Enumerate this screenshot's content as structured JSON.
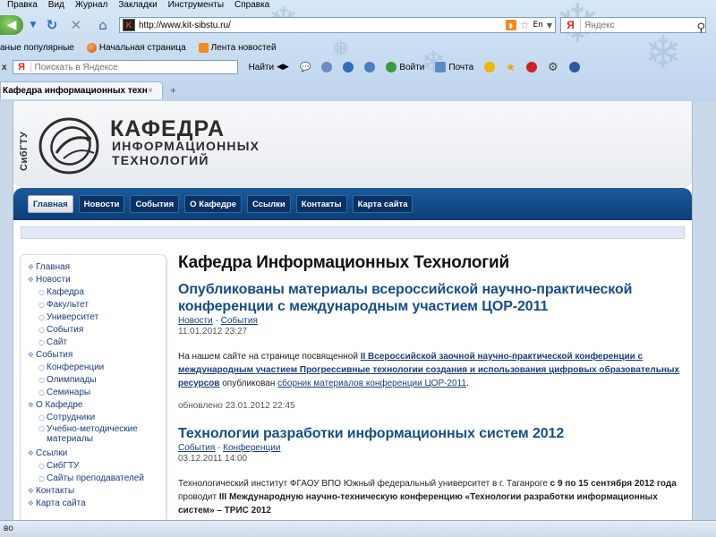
{
  "browser": {
    "menu": [
      "Правка",
      "Вид",
      "Журнал",
      "Закладки",
      "Инструменты",
      "Справка"
    ],
    "url": "http://www.kit-sibstu.ru/",
    "url_lang": "En",
    "search_placeholder": "Яндекс",
    "bookmarks": [
      "аные популярные",
      "Начальная страница",
      "Лента новостей"
    ],
    "yandex_bar": {
      "search_placeholder": "Поискать в Яндексе",
      "find_label": "Найти",
      "login_label": "Войти",
      "mail_label": "Почта"
    },
    "tab_title": "Кафедра информационных техно",
    "status_text": "во"
  },
  "site": {
    "logo_vertical": "СибГТУ",
    "logo_title": "КАФЕДРА",
    "logo_sub1": "ИНФОРМАЦИОННЫХ",
    "logo_sub2": "ТЕХНОЛОГИЙ",
    "nav": [
      "Главная",
      "Новости",
      "События",
      "О Кафедре",
      "Ссылки",
      "Контакты",
      "Карта сайта"
    ],
    "sidebar": [
      {
        "label": "Главная",
        "level": 0
      },
      {
        "label": "Новости",
        "level": 0
      },
      {
        "label": "Кафедра",
        "level": 1
      },
      {
        "label": "Факультет",
        "level": 1
      },
      {
        "label": "Университет",
        "level": 1
      },
      {
        "label": "События",
        "level": 1
      },
      {
        "label": "Сайт",
        "level": 1
      },
      {
        "label": "События",
        "level": 0
      },
      {
        "label": "Конференции",
        "level": 1
      },
      {
        "label": "Олимпиады",
        "level": 1
      },
      {
        "label": "Семинары",
        "level": 1
      },
      {
        "label": "О Кафедре",
        "level": 0
      },
      {
        "label": "Сотрудники",
        "level": 1
      },
      {
        "label": "Учебно-методические материалы",
        "level": 1
      },
      {
        "label": "Ссылки",
        "level": 0
      },
      {
        "label": "СибГТУ",
        "level": 1
      },
      {
        "label": "Сайты преподавателей",
        "level": 1
      },
      {
        "label": "Контакты",
        "level": 0
      },
      {
        "label": "Карта сайта",
        "level": 0
      }
    ],
    "page_heading": "Кафедра Информационных Технологий",
    "articles": [
      {
        "title": "Опубликованы материалы всероссийской научно-практической конференции с международным участием ЦОР-2011",
        "tags": [
          "Новости",
          "События"
        ],
        "date": "11.01.2012 23:27",
        "body_intro": "На нашем сайте на странице посвященной ",
        "body_link": "II Всероссийской заочной научно-практической конференции с международным участием Прогрессивные технологии создания и использования цифровых образовательных ресурсов",
        "body_mid": " опубликован ",
        "body_link2": "сборник материалов конференции ЦОР-2011",
        "body_end": ".",
        "updated": "обновлено 23.01.2012 22:45"
      },
      {
        "title": "Технологии разработки информационных систем 2012",
        "tags": [
          "События",
          "Конференции"
        ],
        "date": "03.12.2011 14:00",
        "body_intro": "Технологический институт ФГАОУ ВПО Южный федеральный университет в г. Таганроге ",
        "body_bold1": "с 9 по 15 сентября 2012 года",
        "body_mid": " проводит ",
        "body_bold2": "III Международную научно-техническую конференцию «Технологии разработки информационных систем» – ТРИС 2012"
      }
    ]
  }
}
